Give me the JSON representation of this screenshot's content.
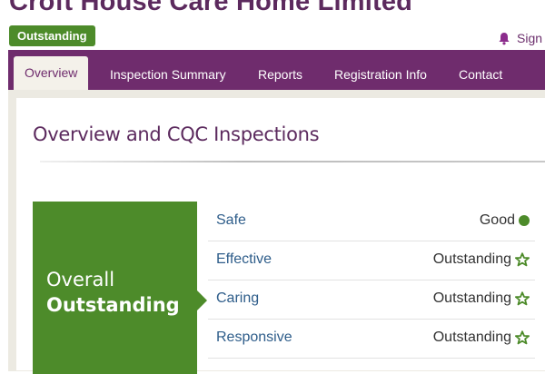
{
  "provider": {
    "name": "Croft House Care Home Limited",
    "badge": "Outstanding"
  },
  "header": {
    "signin_label": "Sign"
  },
  "nav": {
    "tabs": [
      {
        "label": "Overview",
        "active": true
      },
      {
        "label": "Inspection Summary",
        "active": false
      },
      {
        "label": "Reports",
        "active": false
      },
      {
        "label": "Registration Info",
        "active": false
      },
      {
        "label": "Contact",
        "active": false
      }
    ]
  },
  "main": {
    "section_title": "Overview and CQC Inspections",
    "overall": {
      "label": "Overall",
      "value": "Outstanding"
    },
    "domains": [
      {
        "name": "Safe",
        "rating": "Good",
        "icon": "green-dot-icon"
      },
      {
        "name": "Effective",
        "rating": "Outstanding",
        "icon": "star-icon"
      },
      {
        "name": "Caring",
        "rating": "Outstanding",
        "icon": "star-icon"
      },
      {
        "name": "Responsive",
        "rating": "Outstanding",
        "icon": "star-icon"
      }
    ]
  },
  "colors": {
    "brand_purple": "#6f2c6d",
    "outstanding_green": "#4d8b2a",
    "link_blue": "#2e5d8a"
  }
}
